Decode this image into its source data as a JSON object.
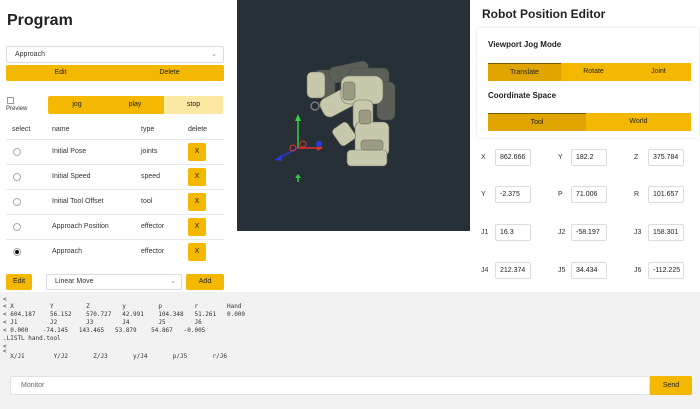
{
  "program": {
    "title": "Program",
    "selected_program": "Approach",
    "edit_label": "Edit",
    "delete_label": "Delete",
    "preview_label": "Preview",
    "mode_buttons": {
      "jog": "jog",
      "play": "play",
      "stop": "stop"
    },
    "columns": {
      "select": "select",
      "name": "name",
      "type": "type",
      "delete": "delete"
    },
    "rows": [
      {
        "name": "Initial Pose",
        "type": "joints",
        "delete": "X",
        "selected": false
      },
      {
        "name": "Initial Speed",
        "type": "speed",
        "delete": "X",
        "selected": false
      },
      {
        "name": "Initial Tool Offset",
        "type": "tool",
        "delete": "X",
        "selected": false
      },
      {
        "name": "Approach Position",
        "type": "effector",
        "delete": "X",
        "selected": false
      },
      {
        "name": "Approach",
        "type": "effector",
        "delete": "X",
        "selected": true
      }
    ],
    "bottom_edit_label": "Edit",
    "move_type": "Linear Move",
    "add_label": "Add"
  },
  "editor": {
    "title": "Robot Position Editor",
    "jog_mode_heading": "Viewport Jog Mode",
    "jog_modes": {
      "translate": "Translate",
      "rotate": "Rotate",
      "joint": "Joint"
    },
    "active_jog_mode": "Translate",
    "coord_heading": "Coordinate Space",
    "coord_spaces": {
      "tool": "Tool",
      "world": "World"
    },
    "active_coord_space": "Tool",
    "fields": [
      {
        "label": "X",
        "value": "862.666"
      },
      {
        "label": "Y",
        "value": "182.2"
      },
      {
        "label": "Z",
        "value": "375.784"
      },
      {
        "label": "Y",
        "value": "-2.375"
      },
      {
        "label": "P",
        "value": "71.006"
      },
      {
        "label": "R",
        "value": "101.657"
      },
      {
        "label": "J1",
        "value": "16.3"
      },
      {
        "label": "J2",
        "value": "-58.197"
      },
      {
        "label": "J3",
        "value": "158.301"
      },
      {
        "label": "J4",
        "value": "212.374"
      },
      {
        "label": "J5",
        "value": "34.434"
      },
      {
        "label": "J6",
        "value": "-112.225"
      }
    ]
  },
  "console": {
    "lines": [
      "<",
      "< X          Y         Z         y         p         r        Hand",
      "< 604.187    56.152    570.727   42.991    104.348   51.261   0.000",
      "< J1         J2        J3        J4        J5        J6",
      "< 0.000    -74.145   143.465   53.879    54.867   -0.005",
      ".LISTL hand.tool",
      "<",
      "<",
      "  X/J1        Y/J2       Z/J3       y/J4       p/J5       r/J6"
    ]
  },
  "monitor": {
    "placeholder": "Monitor",
    "send_label": "Send"
  },
  "colors": {
    "accent": "#f5b800",
    "accent_active": "#e0a500",
    "viewport_bg": "#263036",
    "console_bg": "#f2f2f2"
  }
}
